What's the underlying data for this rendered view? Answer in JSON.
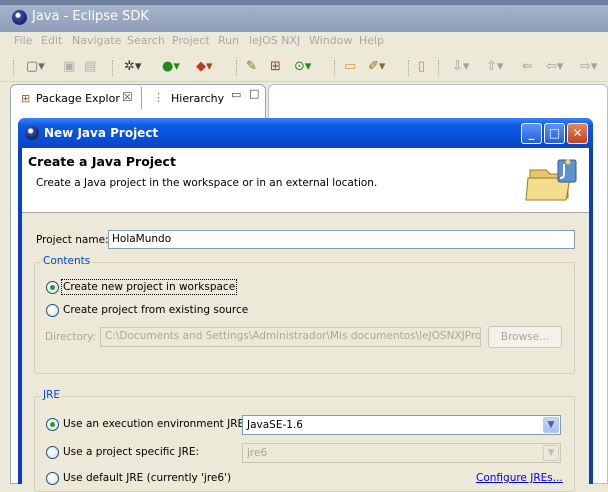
{
  "window": {
    "title": "Java - Eclipse SDK"
  },
  "menubar": [
    "File",
    "Edit",
    "Navigate",
    "Search",
    "Project",
    "Run",
    "leJOS NXJ",
    "Window",
    "Help"
  ],
  "views": {
    "package_explorer": "Package Explor",
    "hierarchy": "Hierarchy",
    "close_glyph": "☒"
  },
  "dialog": {
    "title": "New Java Project",
    "header_title": "Create a Java Project",
    "header_subtitle": "Create a Java project in the workspace or in an external location.",
    "project_name_label": "Project name:",
    "project_name_value": "HolaMundo",
    "contents": {
      "legend": "Contents",
      "option_new": "Create new project in workspace",
      "option_existing": "Create project from existing source",
      "selected": "option_new",
      "directory_label": "Directory:",
      "directory_value": "C:\\Documents and Settings\\Administrador\\Mis documentos\\leJOSNXJProjects",
      "browse_label": "Browse..."
    },
    "jre": {
      "legend": "JRE",
      "option_env": "Use an execution environment JRE:",
      "env_value": "JavaSE-1.6",
      "option_specific": "Use a project specific JRE:",
      "specific_value": "jre6",
      "option_default": "Use default JRE (currently 'jre6')",
      "configure_link": "Configure JREs...",
      "selected": "option_env"
    }
  }
}
